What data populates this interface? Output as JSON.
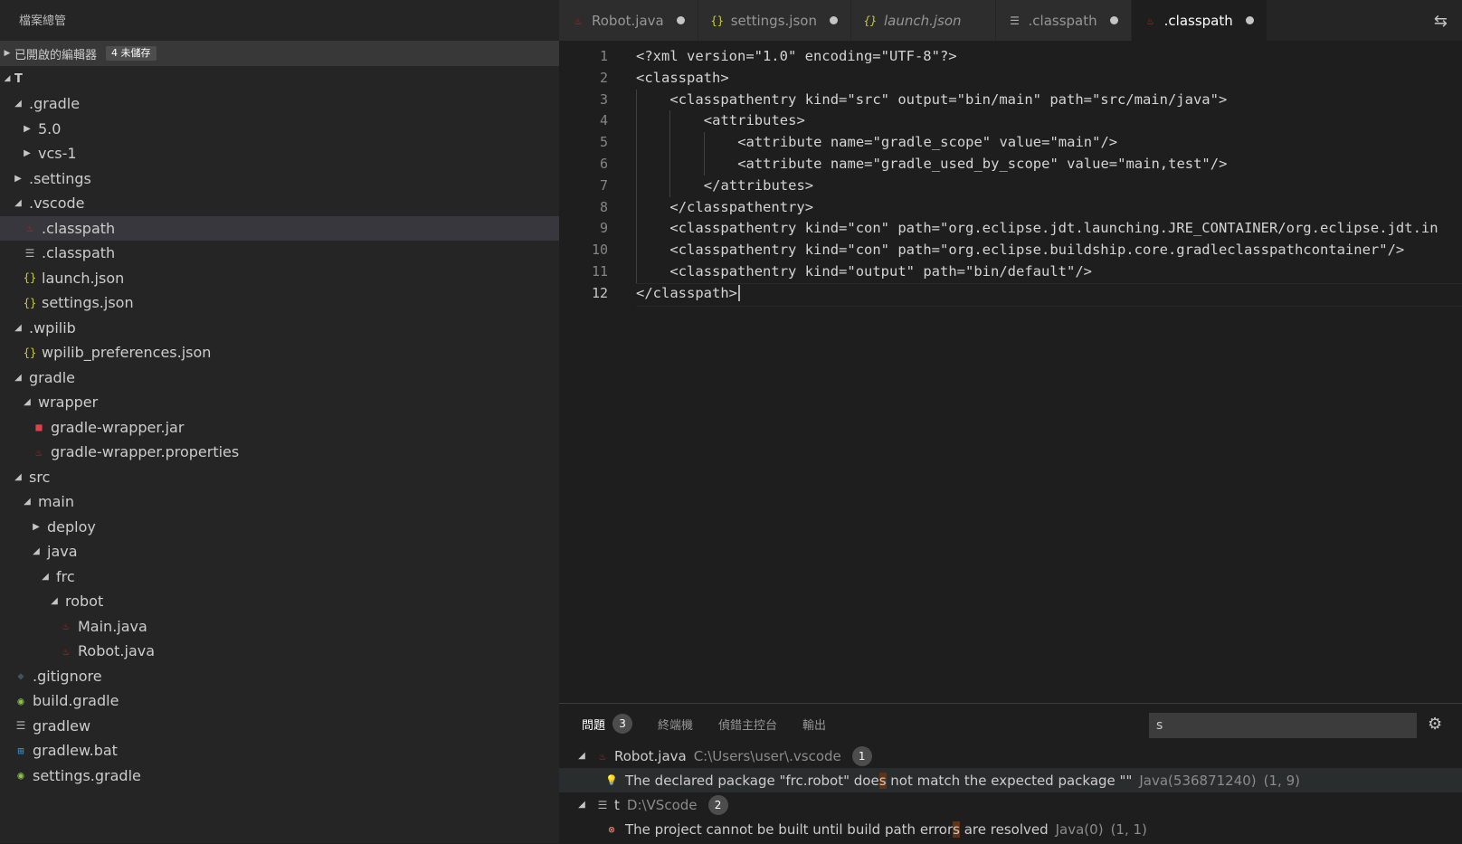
{
  "sidebar": {
    "title": "檔案總管",
    "open_editors": {
      "label": "已開啟的編輯器",
      "badge": "4 未儲存"
    },
    "folder": "T",
    "tree": [
      {
        "label": ".gradle",
        "indent": 1,
        "tw": "open",
        "icon": ""
      },
      {
        "label": "5.0",
        "indent": 2,
        "tw": "closed",
        "icon": ""
      },
      {
        "label": "vcs-1",
        "indent": 2,
        "tw": "closed",
        "icon": ""
      },
      {
        "label": ".settings",
        "indent": 1,
        "tw": "closed",
        "icon": ""
      },
      {
        "label": ".vscode",
        "indent": 1,
        "tw": "open",
        "icon": ""
      },
      {
        "label": ".classpath",
        "indent": 2,
        "tw": "",
        "icon": "java",
        "selected": true
      },
      {
        "label": ".classpath",
        "indent": 2,
        "tw": "",
        "icon": "lines"
      },
      {
        "label": "launch.json",
        "indent": 2,
        "tw": "",
        "icon": "json"
      },
      {
        "label": "settings.json",
        "indent": 2,
        "tw": "",
        "icon": "json"
      },
      {
        "label": ".wpilib",
        "indent": 1,
        "tw": "open",
        "icon": ""
      },
      {
        "label": "wpilib_preferences.json",
        "indent": 2,
        "tw": "",
        "icon": "json"
      },
      {
        "label": "gradle",
        "indent": 1,
        "tw": "open",
        "icon": ""
      },
      {
        "label": "wrapper",
        "indent": 2,
        "tw": "open",
        "icon": ""
      },
      {
        "label": "gradle-wrapper.jar",
        "indent": 3,
        "tw": "",
        "icon": "jar"
      },
      {
        "label": "gradle-wrapper.properties",
        "indent": 3,
        "tw": "",
        "icon": "java"
      },
      {
        "label": "src",
        "indent": 1,
        "tw": "open",
        "icon": ""
      },
      {
        "label": "main",
        "indent": 2,
        "tw": "open",
        "icon": ""
      },
      {
        "label": "deploy",
        "indent": 3,
        "tw": "closed",
        "icon": ""
      },
      {
        "label": "java",
        "indent": 3,
        "tw": "open",
        "icon": ""
      },
      {
        "label": "frc",
        "indent": 4,
        "tw": "open",
        "icon": ""
      },
      {
        "label": "robot",
        "indent": 5,
        "tw": "open",
        "icon": ""
      },
      {
        "label": "Main.java",
        "indent": 6,
        "tw": "",
        "icon": "java"
      },
      {
        "label": "Robot.java",
        "indent": 6,
        "tw": "",
        "icon": "java"
      },
      {
        "label": ".gitignore",
        "indent": 1,
        "tw": "",
        "icon": "git"
      },
      {
        "label": "build.gradle",
        "indent": 1,
        "tw": "",
        "icon": "gradle"
      },
      {
        "label": "gradlew",
        "indent": 1,
        "tw": "",
        "icon": "lines"
      },
      {
        "label": "gradlew.bat",
        "indent": 1,
        "tw": "",
        "icon": "windows"
      },
      {
        "label": "settings.gradle",
        "indent": 1,
        "tw": "",
        "icon": "gradle"
      }
    ]
  },
  "tabs": [
    {
      "label": "Robot.java",
      "icon": "java",
      "dirty": true,
      "active": false,
      "italic": false
    },
    {
      "label": "settings.json",
      "icon": "json",
      "dirty": true,
      "active": false,
      "italic": false
    },
    {
      "label": "launch.json",
      "icon": "json",
      "dirty": false,
      "active": false,
      "italic": true
    },
    {
      "label": ".classpath",
      "icon": "lines",
      "dirty": true,
      "active": false,
      "italic": false
    },
    {
      "label": ".classpath",
      "icon": "java",
      "dirty": true,
      "active": true,
      "italic": false
    }
  ],
  "editor": {
    "current_line": 12,
    "lines": [
      {
        "n": "1",
        "indent": 0,
        "text": "<?xml version=\"1.0\" encoding=\"UTF-8\"?>"
      },
      {
        "n": "2",
        "indent": 0,
        "text": "<classpath>"
      },
      {
        "n": "3",
        "indent": 1,
        "text": "<classpathentry kind=\"src\" output=\"bin/main\" path=\"src/main/java\">"
      },
      {
        "n": "4",
        "indent": 2,
        "text": "<attributes>"
      },
      {
        "n": "5",
        "indent": 3,
        "text": "<attribute name=\"gradle_scope\" value=\"main\"/>"
      },
      {
        "n": "6",
        "indent": 3,
        "text": "<attribute name=\"gradle_used_by_scope\" value=\"main,test\"/>"
      },
      {
        "n": "7",
        "indent": 2,
        "text": "</attributes>"
      },
      {
        "n": "8",
        "indent": 1,
        "text": "</classpathentry>"
      },
      {
        "n": "9",
        "indent": 1,
        "text": "<classpathentry kind=\"con\" path=\"org.eclipse.jdt.launching.JRE_CONTAINER/org.eclipse.jdt.in"
      },
      {
        "n": "10",
        "indent": 1,
        "text": "<classpathentry kind=\"con\" path=\"org.eclipse.buildship.core.gradleclasspathcontainer\"/>"
      },
      {
        "n": "11",
        "indent": 1,
        "text": "<classpathentry kind=\"output\" path=\"bin/default\"/>"
      },
      {
        "n": "12",
        "indent": 0,
        "text": "</classpath>"
      }
    ]
  },
  "panel": {
    "tabs": [
      {
        "label": "問題",
        "count": "3",
        "active": true
      },
      {
        "label": "終端機"
      },
      {
        "label": "偵錯主控台"
      },
      {
        "label": "輸出"
      }
    ],
    "filter_value": "s",
    "groups": [
      {
        "file": "Robot.java",
        "path": "C:\\Users\\user\\.vscode",
        "count": "1",
        "icon": "java",
        "items": [
          {
            "severity": "warning",
            "pre": "The declared package \"frc.robot\" doe",
            "hl": "s",
            "post": " not match the expected package \"\"",
            "source": "Java(536871240)",
            "pos": "(1, 9)"
          }
        ]
      },
      {
        "file": "t",
        "path": "D:\\VScode",
        "count": "2",
        "icon": "lines",
        "items": [
          {
            "severity": "error",
            "pre": "The project cannot be built until build path error",
            "hl": "s",
            "post": " are resolved",
            "source": "Java(0)",
            "pos": "(1, 1)"
          }
        ]
      }
    ]
  },
  "colors": {
    "java": "#c1272d",
    "json": "#cbcb41",
    "lines": "#b3b3b3",
    "jar": "#e0424b",
    "git": "#41535b",
    "gradle": "#8dc149",
    "windows": "#2b95e0"
  }
}
